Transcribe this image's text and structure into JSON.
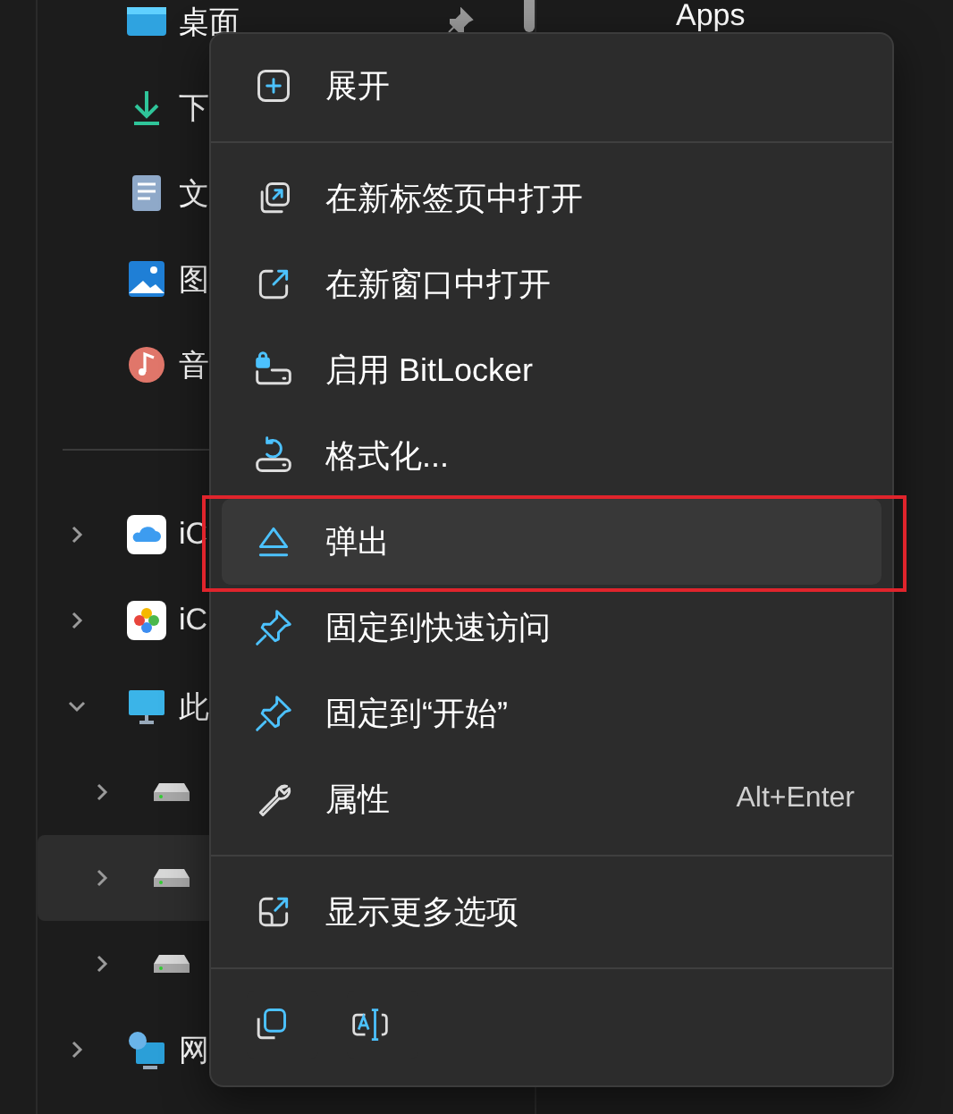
{
  "sidebar": {
    "quick_access": [
      {
        "label": "桌面",
        "pinned": true
      },
      {
        "label": "下"
      },
      {
        "label": "文"
      },
      {
        "label": "图"
      },
      {
        "label": "音"
      }
    ],
    "locations": [
      {
        "label": "iC",
        "expanded": false,
        "selected": false
      },
      {
        "label": "iC",
        "expanded": false,
        "selected": false
      },
      {
        "label": "此",
        "expanded": true,
        "selected": false,
        "children": [
          {
            "selected": false
          },
          {
            "selected": true
          },
          {
            "selected": false
          }
        ]
      },
      {
        "label": "网",
        "expanded": false,
        "selected": false
      }
    ]
  },
  "content": {
    "heading": "Apps"
  },
  "context_menu": {
    "items": [
      {
        "kind": "command",
        "label": "展开",
        "selected": false
      },
      {
        "kind": "separator"
      },
      {
        "kind": "command",
        "label": "在新标签页中打开",
        "selected": false
      },
      {
        "kind": "command",
        "label": "在新窗口中打开",
        "selected": false
      },
      {
        "kind": "command",
        "label": "启用 BitLocker",
        "selected": false
      },
      {
        "kind": "command",
        "label": "格式化...",
        "selected": false
      },
      {
        "kind": "command",
        "label": "弹出",
        "selected": true
      },
      {
        "kind": "command",
        "label": "固定到快速访问",
        "selected": false
      },
      {
        "kind": "command",
        "label": "固定到“开始”",
        "selected": false
      },
      {
        "kind": "command",
        "label": "属性",
        "shortcut": "Alt+Enter",
        "selected": false
      },
      {
        "kind": "separator"
      },
      {
        "kind": "command",
        "label": "显示更多选项",
        "selected": false
      },
      {
        "kind": "separator"
      },
      {
        "kind": "icon-bar"
      }
    ]
  }
}
